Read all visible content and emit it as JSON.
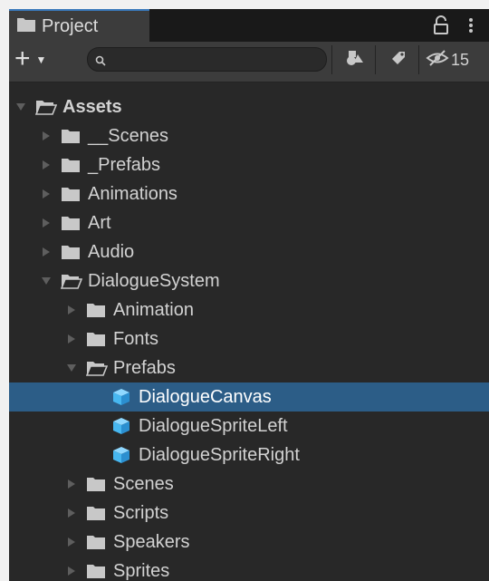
{
  "window": {
    "tab_title": "Project",
    "hidden_count": "15",
    "icons": [
      "folder-icon",
      "lock-icon",
      "kebab-menu-icon"
    ]
  },
  "toolbar": {
    "create_label": "+",
    "search": {
      "value": "",
      "placeholder": ""
    },
    "buttons": [
      "filter-by-type-icon",
      "filter-by-label-icon",
      "hidden-packages-icon"
    ]
  },
  "colors": {
    "panel_bg": "#282828",
    "toolbar_bg": "#3c3c3c",
    "selection": "#2c5d87",
    "tab_accent": "#3a79bb",
    "prefab_blue": "#47b7f0"
  },
  "tree": [
    {
      "label": "Assets",
      "depth": 0,
      "kind": "folder",
      "expanded": true,
      "bold": true
    },
    {
      "label": "__Scenes",
      "depth": 1,
      "kind": "folder",
      "expanded": false
    },
    {
      "label": "_Prefabs",
      "depth": 1,
      "kind": "folder",
      "expanded": false
    },
    {
      "label": "Animations",
      "depth": 1,
      "kind": "folder",
      "expanded": false
    },
    {
      "label": "Art",
      "depth": 1,
      "kind": "folder",
      "expanded": false
    },
    {
      "label": "Audio",
      "depth": 1,
      "kind": "folder",
      "expanded": false
    },
    {
      "label": "DialogueSystem",
      "depth": 1,
      "kind": "folder",
      "expanded": true
    },
    {
      "label": "Animation",
      "depth": 2,
      "kind": "folder",
      "expanded": false
    },
    {
      "label": "Fonts",
      "depth": 2,
      "kind": "folder",
      "expanded": false
    },
    {
      "label": "Prefabs",
      "depth": 2,
      "kind": "folder",
      "expanded": true
    },
    {
      "label": "DialogueCanvas",
      "depth": 3,
      "kind": "prefab",
      "selected": true
    },
    {
      "label": "DialogueSpriteLeft",
      "depth": 3,
      "kind": "prefab"
    },
    {
      "label": "DialogueSpriteRight",
      "depth": 3,
      "kind": "prefab"
    },
    {
      "label": "Scenes",
      "depth": 2,
      "kind": "folder",
      "expanded": false
    },
    {
      "label": "Scripts",
      "depth": 2,
      "kind": "folder",
      "expanded": false
    },
    {
      "label": "Speakers",
      "depth": 2,
      "kind": "folder",
      "expanded": false
    },
    {
      "label": "Sprites",
      "depth": 2,
      "kind": "folder",
      "expanded": false
    }
  ]
}
